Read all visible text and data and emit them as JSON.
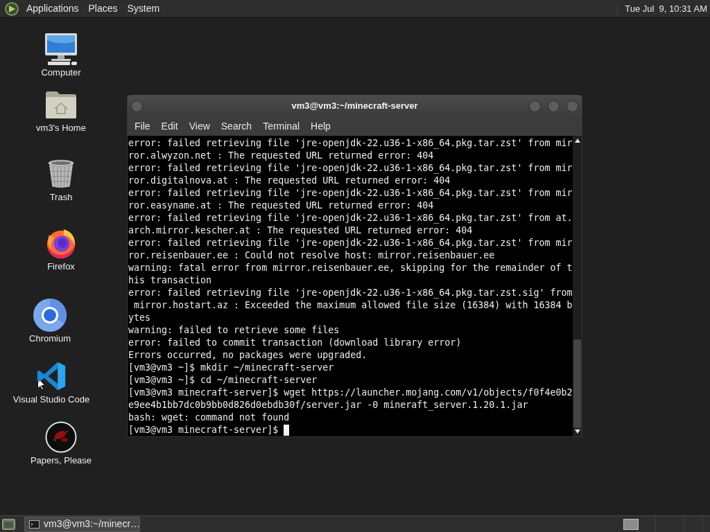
{
  "top_panel": {
    "menus": [
      "Applications",
      "Places",
      "System"
    ],
    "clock": "Tue Jul  9, 10:31 AM"
  },
  "desktop_icons": [
    {
      "label": "Computer",
      "kind": "computer"
    },
    {
      "label": "vm3's Home",
      "kind": "home"
    },
    {
      "label": "Trash",
      "kind": "trash"
    },
    {
      "label": "Firefox",
      "kind": "firefox"
    },
    {
      "label": "Chromium",
      "kind": "chromium"
    },
    {
      "label": "Visual Studio Code",
      "kind": "vscode"
    },
    {
      "label": "Papers, Please",
      "kind": "papers"
    }
  ],
  "terminal_window": {
    "title": "vm3@vm3:~/minecraft-server",
    "menu": [
      "File",
      "Edit",
      "View",
      "Search",
      "Terminal",
      "Help"
    ],
    "lines": [
      "error: failed retrieving file 'jre-openjdk-22.u36-1-x86_64.pkg.tar.zst' from mir",
      "ror.alwyzon.net : The requested URL returned error: 404",
      "error: failed retrieving file 'jre-openjdk-22.u36-1-x86_64.pkg.tar.zst' from mir",
      "ror.digitalnova.at : The requested URL returned error: 404",
      "error: failed retrieving file 'jre-openjdk-22.u36-1-x86_64.pkg.tar.zst' from mir",
      "ror.easyname.at : The requested URL returned error: 404",
      "error: failed retrieving file 'jre-openjdk-22.u36-1-x86_64.pkg.tar.zst' from at.",
      "arch.mirror.kescher.at : The requested URL returned error: 404",
      "error: failed retrieving file 'jre-openjdk-22.u36-1-x86_64.pkg.tar.zst' from mir",
      "ror.reisenbauer.ee : Could not resolve host: mirror.reisenbauer.ee",
      "warning: fatal error from mirror.reisenbauer.ee, skipping for the remainder of t",
      "his transaction",
      "error: failed retrieving file 'jre-openjdk-22.u36-1-x86_64.pkg.tar.zst.sig' from",
      " mirror.hostart.az : Exceeded the maximum allowed file size (16384) with 16384 b",
      "ytes",
      "warning: failed to retrieve some files",
      "error: failed to commit transaction (download library error)",
      "Errors occurred, no packages were upgraded.",
      "[vm3@vm3 ~]$ mkdir ~/minecraft-server",
      "[vm3@vm3 ~]$ cd ~/minecraft-server",
      "[vm3@vm3 minecraft-server]$ wget https://launcher.mojang.com/v1/objects/f0f4e0b2",
      "e9ee4b1bb7dc0b9bb0d826d0ebdb30f/server.jar -0 mineraft_server.1.20.1.jar",
      "bash: wget: command not found",
      "[vm3@vm3 minecraft-server]$"
    ],
    "cursor": true
  },
  "taskbar": {
    "tasks": [
      {
        "label": "vm3@vm3:~/minecr…",
        "selected": true
      }
    ]
  }
}
